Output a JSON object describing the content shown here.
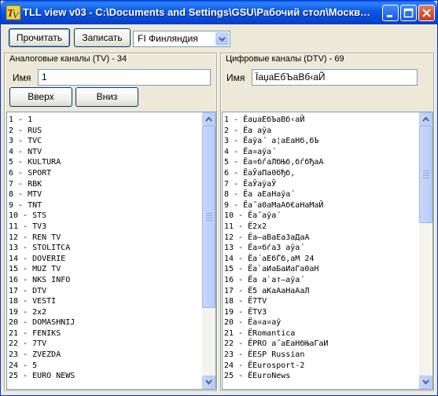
{
  "window": {
    "title": "TLL view v03 - C:\\Documents and Settings\\GSU\\Рабочий стол\\Москва\\...",
    "icon": "app-logo-icon",
    "controls": [
      "minimize-icon",
      "maximize-icon",
      "close-icon"
    ]
  },
  "toolbar": {
    "read_label": "Прочитать",
    "write_label": "Записать",
    "country_value": "FI Финляндия"
  },
  "analog": {
    "header": "Аналоговые каналы (TV) - 34",
    "name_label": "Имя",
    "name_value": "1",
    "up_label": "Вверх",
    "down_label": "Вниз",
    "items": [
      "1 - 1",
      "2 - RUS",
      "3 - TVC",
      "4 - NTV",
      "5 - KULTURA",
      "6 - SPORT",
      "7 - RBK",
      "8 - MTV",
      "9 - TNT",
      "10 - STS",
      "11 - TV3",
      "12 - REN TV",
      "13 - STOLITCA",
      "14 - DOVERIE",
      "15 - MUZ TV",
      "16 - NKS INFO",
      "17 - DTV",
      "18 - VESTI",
      "19 - 2x2",
      "20 - DOMASHNIJ",
      "21 - FENIKS",
      "22 - 7TV",
      "23 - ZVEZDA",
      "24 - 5",
      "25 - EURO NEWS"
    ]
  },
  "digital": {
    "header": "Цифровые каналы (DTV) - 69",
    "name_label": "Имя",
    "name_value": "ЇаџаЕбЪаВб‹аЙ",
    "items": [
      "1 - ЁаџаЕбЪаВб‹аЙ",
      "2 - Ёа аўа",
      "3 - Ёаўа´ а¦аЕаНб,бЪ",
      "4 - Ёа¤аўа´",
      "5 - Ёа¤бѓаЛбЊб,бѓбЂаА",
      "6 - ЁаЎаПа0бЂб,",
      "7 - ЁаЎаўаЎ",
      "8 - Ёа аЕаНаўа´",
      "9 - Ёа˝а0аМаАб€аНаМаЙ",
      "10 - Ёа˝аўа´",
      "11 - Ё2x2",
      "12 - Ёа–аВаЕаЗаДаА",
      "13 - Ёа¤бѓаЗ аўа´",
      "14 - Ёа´аЕбЃб,аМ 24",
      "15 - Ёа`аИаБаИаГа0аН",
      "16 - Ёа а`ат–аўа´",
      "17 - Ё5 аКаАаНаАаЛ",
      "18 - Ё7TV",
      "19 - ЁTV3",
      "20 - Ёа¤а¤аў",
      "21 - ЁRomantica",
      "22 - ЁPRO а˝аЕаНбЊаГаИ",
      "23 - ЁESP Russian",
      "24 - ЁEurosport-2",
      "25 - ЁEuroNews"
    ]
  },
  "colors": {
    "titlebar": "#0a4cd4",
    "window_bg": "#ece9d8",
    "scroll_accent": "#c1d3fb"
  }
}
